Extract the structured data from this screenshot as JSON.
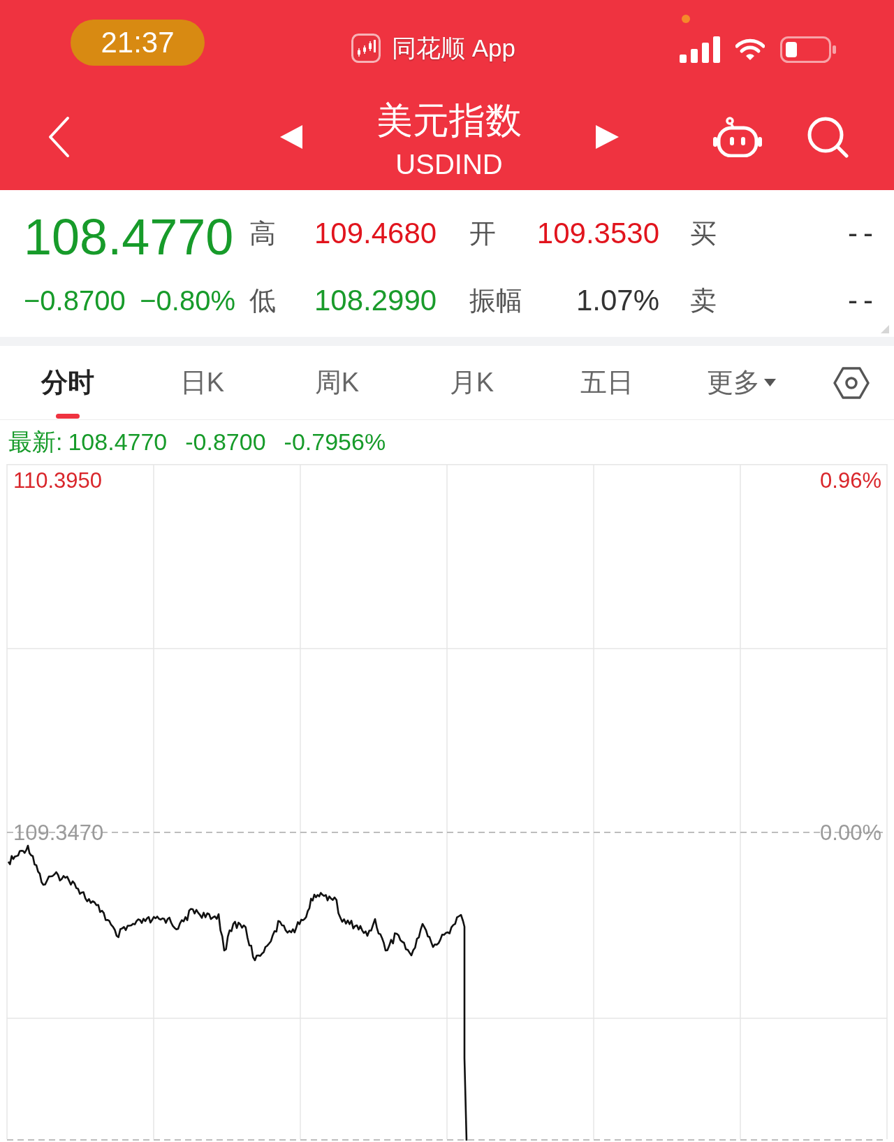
{
  "status_bar": {
    "time": "21:37",
    "app": "同花顺 App"
  },
  "header": {
    "title": "美元指数",
    "code": "USDIND"
  },
  "quote": {
    "rising": false,
    "price": "108.4770",
    "change": "−0.8700",
    "change_percent": "−0.80%"
  },
  "stats": [
    {
      "label": "高",
      "value": "109.4680",
      "color": "#e1141d"
    },
    {
      "label": "开",
      "value": "109.3530",
      "color": "#e1141d"
    },
    {
      "label": "买",
      "value": "--",
      "color": "#333333"
    },
    {
      "label": "低",
      "value": "108.2990",
      "color": "#1a9b2b"
    },
    {
      "label": "振幅",
      "value": "1.07%",
      "color": "#333333"
    },
    {
      "label": "卖",
      "value": "--",
      "color": "#333333"
    }
  ],
  "tabs": [
    {
      "label": "分时",
      "selected": true,
      "kind": "tab"
    },
    {
      "label": "日K",
      "selected": false,
      "kind": "tab"
    },
    {
      "label": "周K",
      "selected": false,
      "kind": "tab"
    },
    {
      "label": "月K",
      "selected": false,
      "kind": "tab"
    },
    {
      "label": "五日",
      "selected": false,
      "kind": "tab"
    },
    {
      "label": "更多",
      "selected": false,
      "kind": "menu"
    }
  ],
  "latest": {
    "label": "最新:",
    "price": "108.4770",
    "change": "-0.8700",
    "change_percent": "-0.7956%"
  },
  "chart": {
    "top_price": "110.3950",
    "top_percent": "0.96%",
    "base_price": "109.3470",
    "base_percent": "0.00%"
  }
}
